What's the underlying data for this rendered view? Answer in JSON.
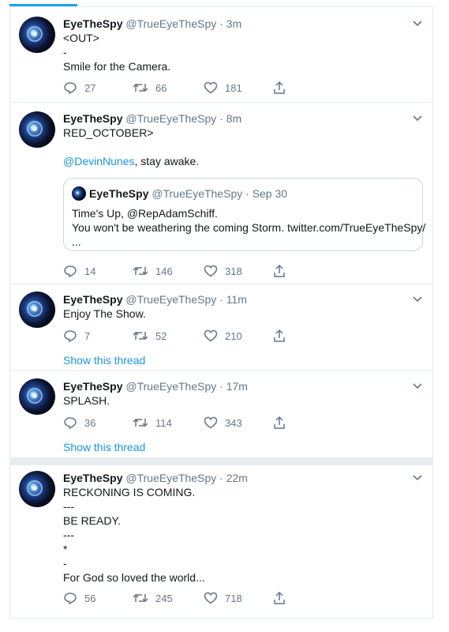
{
  "account": {
    "name": "EyeTheSpy",
    "handle": "@TrueEyeTheSpy",
    "separator": "·"
  },
  "tweets": [
    {
      "time": "3m",
      "lines": [
        "<OUT>",
        "-",
        "Smile for the Camera."
      ],
      "replies": "27",
      "retweets": "66",
      "likes": "181"
    },
    {
      "time": "8m",
      "lines": [
        "RED_OCTOBER>"
      ],
      "mention": "@DevinNunes",
      "mention_suffix": ", stay awake.",
      "quote": {
        "time": "Sep 30",
        "lines": [
          "Time's Up, @RepAdamSchiff.",
          "You won't be weathering the coming Storm. twitter.com/TrueEyeTheSpy/",
          "..."
        ]
      },
      "replies": "14",
      "retweets": "146",
      "likes": "318"
    },
    {
      "time": "11m",
      "lines": [
        "Enjoy The Show."
      ],
      "replies": "7",
      "retweets": "52",
      "likes": "210",
      "thread_link": "Show this thread"
    },
    {
      "time": "17m",
      "lines": [
        "SPLASH."
      ],
      "replies": "36",
      "retweets": "114",
      "likes": "343",
      "thread_link": "Show this thread"
    },
    {
      "time": "22m",
      "lines": [
        "RECKONING IS COMING.",
        "---",
        "BE READY.",
        "---",
        "*",
        "-",
        "For God so loved the world..."
      ],
      "replies": "56",
      "retweets": "245",
      "likes": "718"
    }
  ],
  "icons": {
    "reply": "reply-icon",
    "retweet": "retweet-icon",
    "like": "like-icon",
    "share": "share-icon",
    "caret": "chevron-down-icon",
    "avatar": "avatar"
  },
  "colors": {
    "link": "#1b95e0",
    "muted": "#657786",
    "border": "#e6ecf0",
    "accent": "#1da1f2"
  }
}
